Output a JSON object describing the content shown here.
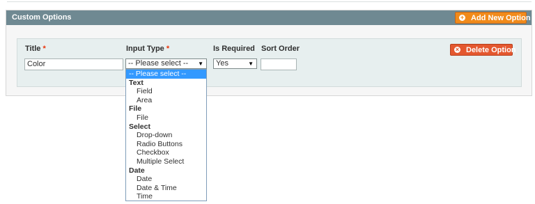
{
  "section": {
    "title": "Custom Options",
    "add_button_label": "Add New Option"
  },
  "option_row": {
    "delete_button_label": "Delete Option",
    "columns": {
      "title": "Title",
      "input_type": "Input Type",
      "is_required": "Is Required",
      "sort_order": "Sort Order"
    },
    "required_marker": "*",
    "title_value": "Color",
    "input_type_value": "-- Please select --",
    "is_required_value": "Yes",
    "sort_order_value": ""
  },
  "dropdown": {
    "selected": "-- Please select --",
    "groups": [
      {
        "label": "Text",
        "options": [
          "Field",
          "Area"
        ]
      },
      {
        "label": "File",
        "options": [
          "File"
        ]
      },
      {
        "label": "Select",
        "options": [
          "Drop-down",
          "Radio Buttons",
          "Checkbox",
          "Multiple Select"
        ]
      },
      {
        "label": "Date",
        "options": [
          "Date",
          "Date & Time",
          "Time"
        ]
      }
    ]
  },
  "icons": {
    "add": "plus-circle-icon",
    "delete": "x-circle-icon",
    "select_arrow": "triangle-down-icon"
  },
  "colors": {
    "header_bg": "#6f8992",
    "add_button": "#f18a1a",
    "delete_button": "#e4582f",
    "selected_option": "#3399ff",
    "required_star": "#eb340a"
  }
}
